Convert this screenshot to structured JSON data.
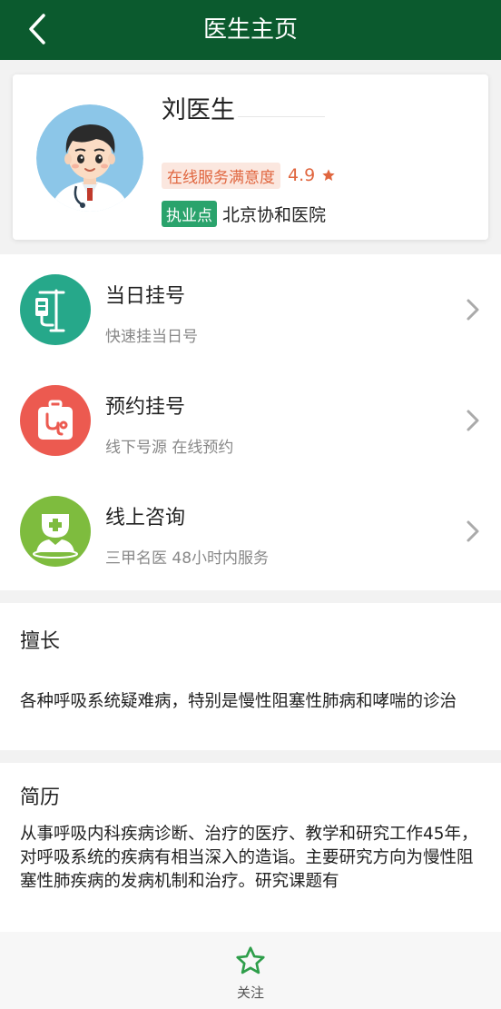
{
  "header": {
    "title": "医生主页"
  },
  "profile": {
    "name": "刘医生",
    "satisfaction_label": "在线服务满意度",
    "satisfaction_score": "4.9",
    "location_badge": "执业点",
    "hospital": "北京协和医院"
  },
  "services": [
    {
      "title": "当日挂号",
      "subtitle": "快速挂当日号",
      "icon": "iv-drip-icon",
      "color": "#26a88a"
    },
    {
      "title": "预约挂号",
      "subtitle": "线下号源 在线预约",
      "icon": "medical-kit-icon",
      "color": "#ec5a50"
    },
    {
      "title": "线上咨询",
      "subtitle": "三甲名医 48小时内服务",
      "icon": "online-doctor-icon",
      "color": "#7ebc3e"
    }
  ],
  "specialty": {
    "title": "擅长",
    "body": "各种呼吸系统疑难病，特别是慢性阻塞性肺病和哮喘的诊治"
  },
  "resume": {
    "title": "简历",
    "body": "从事呼吸内科疾病诊断、治疗的医疗、教学和研究工作45年，对呼吸系统的疾病有相当深入的造诣。主要研究方向为慢性阻塞性肺疾病的发病机制和治疗。研究课题有"
  },
  "bottom": {
    "follow_label": "关注"
  },
  "colors": {
    "header_bg": "#0b5a2e",
    "accent_orange": "#e0663f",
    "badge_green": "#2aa36c",
    "follow_green": "#2e9e4a"
  }
}
